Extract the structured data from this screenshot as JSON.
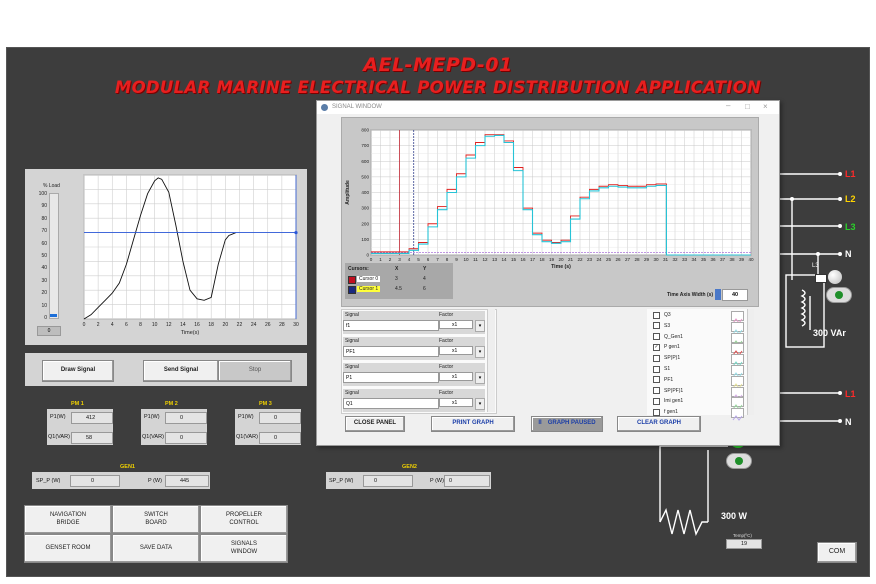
{
  "header": {
    "line1": "AEL-MEPD-01",
    "line2": "MODULAR MARINE ELECTRICAL POWER DISTRIBUTION APPLICATION"
  },
  "left_chart": {
    "yaxis_title": "% Load",
    "y_ticks": [
      "100",
      "90",
      "80",
      "70",
      "60",
      "50",
      "40",
      "30",
      "20",
      "10",
      "0"
    ],
    "x_ticks": [
      "0",
      "2",
      "4",
      "6",
      "8",
      "10",
      "12",
      "14",
      "16",
      "18",
      "20",
      "22",
      "24",
      "26",
      "28",
      "30"
    ],
    "xlabel": "Time(s)",
    "bar_value": "0"
  },
  "chart_data": [
    {
      "type": "line",
      "title": "",
      "xlabel": "Time(s)",
      "ylabel": "% Load",
      "xlim": [
        0,
        30
      ],
      "ylim": [
        0,
        100
      ],
      "series": [
        {
          "x": [
            0,
            1,
            2,
            3,
            4,
            5,
            6,
            7,
            8,
            9,
            10,
            10.5,
            11,
            12,
            13,
            14,
            15,
            16,
            17,
            18,
            19,
            20,
            20.5,
            21,
            21.5
          ],
          "y": [
            0,
            3,
            8,
            13,
            18,
            25,
            38,
            55,
            72,
            87,
            96,
            98,
            97,
            88,
            65,
            40,
            20,
            14,
            13,
            15,
            38,
            55,
            58,
            59,
            60
          ]
        },
        {
          "x": [
            0,
            30
          ],
          "y": [
            60,
            60
          ]
        }
      ]
    },
    {
      "type": "line",
      "title": "",
      "xlabel": "Time (s)",
      "ylabel": "Amplitude",
      "xlim": [
        0,
        40
      ],
      "ylim": [
        0,
        800
      ],
      "series": [
        {
          "name": "P gen1",
          "x": [
            0,
            3,
            4,
            5,
            6,
            7,
            8,
            9,
            10,
            11,
            12,
            13,
            14,
            15,
            16,
            17,
            18,
            19,
            20,
            21,
            22,
            23,
            24,
            25,
            26,
            27,
            28,
            29,
            30,
            31,
            31.1,
            40
          ],
          "y": [
            20,
            20,
            40,
            80,
            200,
            310,
            420,
            520,
            640,
            720,
            770,
            770,
            730,
            560,
            300,
            140,
            95,
            80,
            95,
            250,
            370,
            420,
            440,
            450,
            445,
            440,
            440,
            450,
            455,
            455,
            0,
            0
          ]
        },
        {
          "name": "S1",
          "x": [
            0,
            3,
            4,
            5,
            6,
            7,
            8,
            9,
            10,
            11,
            12,
            13,
            14,
            15,
            16,
            17,
            18,
            19,
            20,
            21,
            22,
            23,
            24,
            25,
            26,
            27,
            28,
            29,
            30,
            31,
            31.1,
            40
          ],
          "y": [
            10,
            10,
            30,
            70,
            180,
            290,
            400,
            500,
            620,
            700,
            760,
            765,
            720,
            540,
            290,
            130,
            85,
            75,
            85,
            230,
            360,
            410,
            430,
            440,
            435,
            430,
            430,
            440,
            445,
            445,
            0,
            0
          ]
        }
      ]
    }
  ],
  "left_buttons": {
    "draw": "Draw Signal",
    "send": "Send Signal",
    "stop": "Stop"
  },
  "pm": [
    {
      "title": "PM 1",
      "p_label": "P1(W)",
      "p_value": "412",
      "q_label": "Q1(VAR)",
      "q_value": "58"
    },
    {
      "title": "PM 2",
      "p_label": "P1(W)",
      "p_value": "0",
      "q_label": "Q1(VAR)",
      "q_value": "0"
    },
    {
      "title": "PM 3",
      "p_label": "P1(W)",
      "p_value": "0",
      "q_label": "Q1(VAR)",
      "q_value": "0"
    }
  ],
  "gen1": {
    "title": "GEN1",
    "sp_label": "SP_P (W)",
    "sp_value": "0",
    "p_label": "P (W)",
    "p_value": "445"
  },
  "gen2": {
    "title": "GEN2",
    "sp_label": "SP_P (W)",
    "sp_value": "0",
    "p_label": "P (W)",
    "p_value": "0"
  },
  "nav": [
    "NAVIGATION BRIDGE",
    "SWITCH BOARD",
    "PROPELLER CONTROL",
    "GENSET ROOM",
    "SAVE DATA",
    "SIGNALS WINDOW"
  ],
  "window": {
    "title": "SIGNAL WINDOW",
    "y_ticks": [
      "800",
      "700",
      "600",
      "500",
      "400",
      "300",
      "200",
      "100",
      "0"
    ],
    "x_ticks": [
      "0",
      "1",
      "2",
      "3",
      "4",
      "5",
      "6",
      "7",
      "8",
      "9",
      "10",
      "11",
      "12",
      "13",
      "14",
      "15",
      "16",
      "17",
      "18",
      "19",
      "20",
      "21",
      "22",
      "23",
      "24",
      "25",
      "26",
      "27",
      "28",
      "29",
      "30",
      "31",
      "32",
      "33",
      "34",
      "35",
      "36",
      "37",
      "38",
      "39",
      "40"
    ],
    "ylabel": "Amplitude",
    "xlabel": "Time (s)",
    "cursors": {
      "header": "Cursors:",
      "x": "X",
      "y": "Y",
      "rows": [
        {
          "name": "Cursor 0",
          "x": "3",
          "y": "4"
        },
        {
          "name": "Cursor 1",
          "x": "4.5",
          "y": "6"
        }
      ]
    },
    "time_axis_label": "Time Axis Width (s)",
    "time_axis_value": "40",
    "signal_label": "Signal",
    "factor_label": "Factor",
    "signals": [
      {
        "name": "f1",
        "factor": "x1"
      },
      {
        "name": "PF1",
        "factor": "x1"
      },
      {
        "name": "P1",
        "factor": "x1"
      },
      {
        "name": "Q1",
        "factor": "x1"
      }
    ],
    "checklist": [
      {
        "label": "Q3",
        "checked": false
      },
      {
        "label": "S3",
        "checked": false
      },
      {
        "label": "Q_Gen1",
        "checked": false
      },
      {
        "label": "P gen1",
        "checked": true
      },
      {
        "label": "SP(P)1",
        "checked": false
      },
      {
        "label": "S1",
        "checked": false
      },
      {
        "label": "PF1",
        "checked": false
      },
      {
        "label": "SP(PF)1",
        "checked": false
      },
      {
        "label": "Imi gen1",
        "checked": false
      },
      {
        "label": "f gen1",
        "checked": false
      }
    ],
    "buttons": {
      "close": "CLOSE PANEL",
      "print": "PRINT GRAPH",
      "paused": "GRAPH PAUSED",
      "paused_mark": "II",
      "clear": "CLEAR GRAPH"
    }
  },
  "right": {
    "l1": "L1",
    "l2": "L2",
    "l3": "L3",
    "n": "N",
    "l3_small": "L3",
    "var": "300 VAr",
    "w": "300 W",
    "temp_label": "Temp(ºC)",
    "temp_value": "19",
    "com": "COM"
  },
  "colors": {
    "accent": "#e81f1f",
    "series_red": "#e0201e",
    "series_cyan": "#27c3d6",
    "line_blue": "#2a57d8"
  }
}
